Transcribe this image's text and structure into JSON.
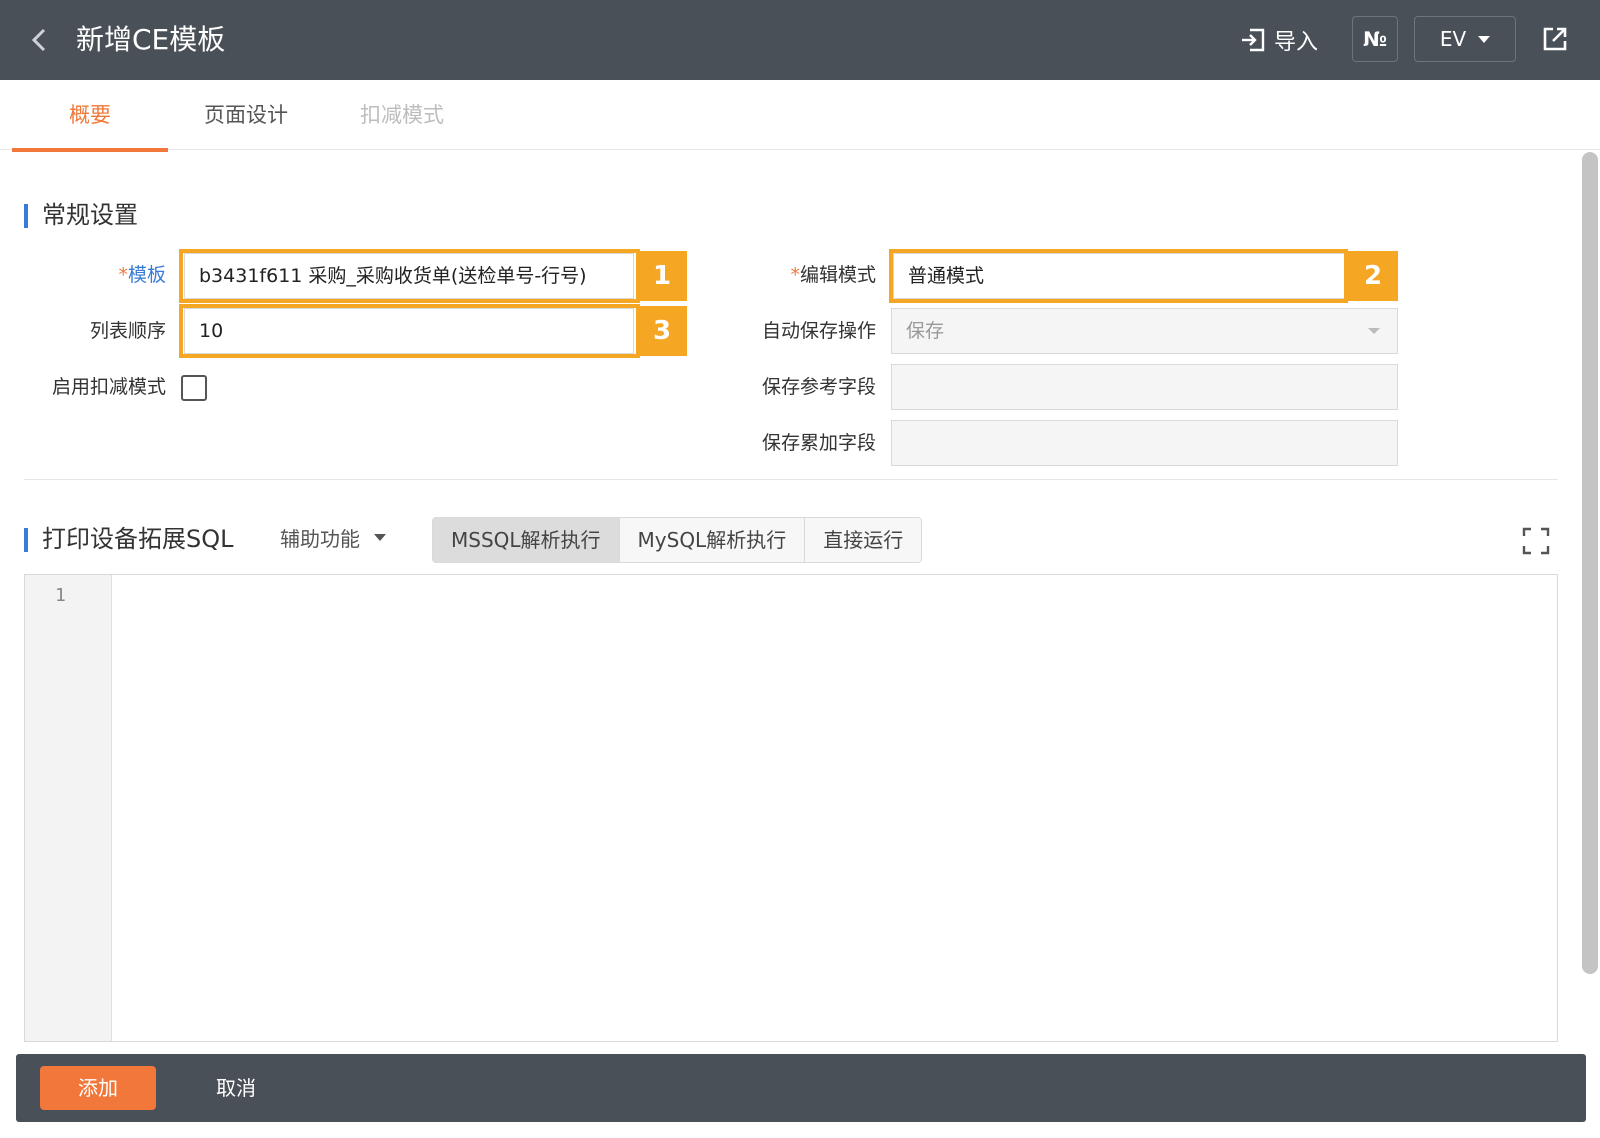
{
  "header": {
    "title": "新增CE模板",
    "import_label": "导入",
    "no_label": "№",
    "env_label": "EV"
  },
  "tabs": [
    {
      "label": "概要",
      "state": "active"
    },
    {
      "label": "页面设计",
      "state": "normal"
    },
    {
      "label": "扣减模式",
      "state": "disabled"
    }
  ],
  "general": {
    "title": "常规设置",
    "template_label": "模板",
    "template_value": "b3431f611 采购_采购收货单(送检单号-行号)",
    "list_order_label": "列表顺序",
    "list_order_value": "10",
    "deduction_label": "启用扣减模式",
    "deduction_checked": false,
    "edit_mode_label": "编辑模式",
    "edit_mode_value": "普通模式",
    "auto_save_label": "自动保存操作",
    "auto_save_value": "保存",
    "save_ref_label": "保存参考字段",
    "save_ref_value": "",
    "save_acc_label": "保存累加字段",
    "save_acc_value": ""
  },
  "badges": [
    "1",
    "2",
    "3"
  ],
  "sql": {
    "title": "打印设备拓展SQL",
    "assist_label": "辅助功能",
    "buttons": [
      "MSSQL解析执行",
      "MySQL解析执行",
      "直接运行"
    ],
    "active_button": "MSSQL解析执行",
    "line_number": "1"
  },
  "footer": {
    "add_label": "添加",
    "cancel_label": "取消"
  },
  "colors": {
    "header_bg": "#495057",
    "accent": "#f2773a",
    "highlight": "#f5a623",
    "section_marker": "#3a7bd5"
  }
}
